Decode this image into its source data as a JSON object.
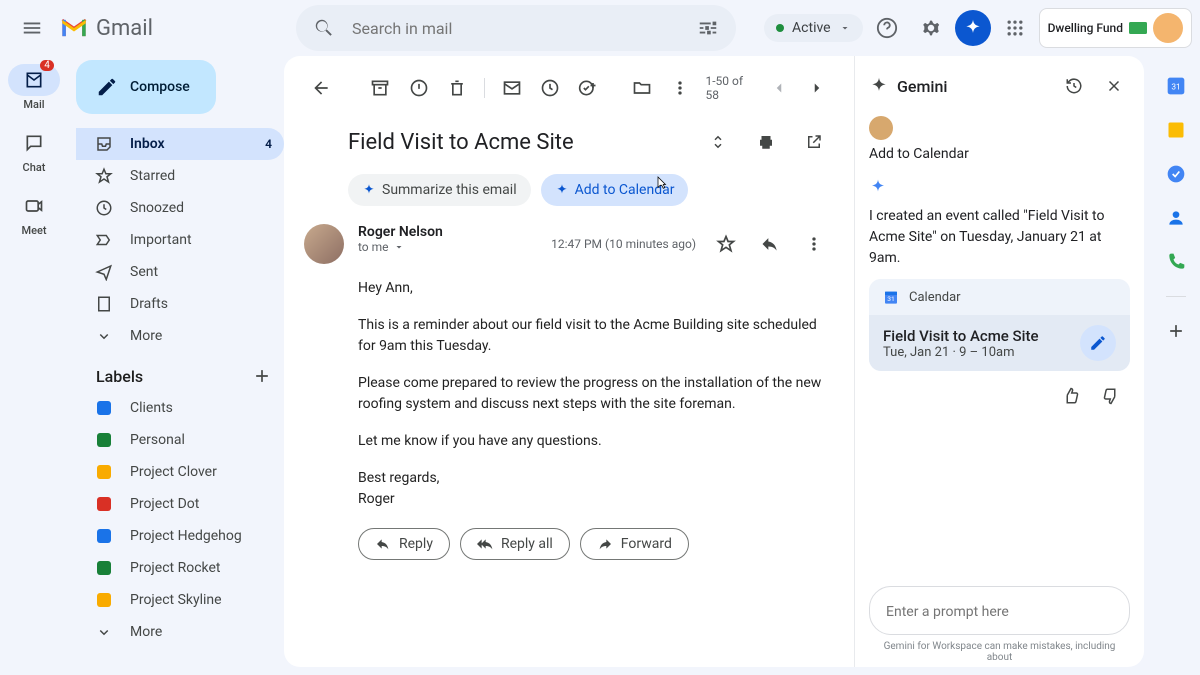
{
  "header": {
    "app_name": "Gmail",
    "search_placeholder": "Search in mail",
    "status": "Active",
    "org_name": "Dwelling Fund"
  },
  "rail": {
    "items": [
      {
        "label": "Mail",
        "badge": "4"
      },
      {
        "label": "Chat"
      },
      {
        "label": "Meet"
      }
    ]
  },
  "compose_label": "Compose",
  "nav": [
    {
      "label": "Inbox",
      "count": "4",
      "active": true
    },
    {
      "label": "Starred"
    },
    {
      "label": "Snoozed"
    },
    {
      "label": "Important"
    },
    {
      "label": "Sent"
    },
    {
      "label": "Drafts"
    },
    {
      "label": "More"
    }
  ],
  "labels_header": "Labels",
  "labels": [
    {
      "label": "Clients",
      "color": "#1a73e8"
    },
    {
      "label": "Personal",
      "color": "#188038"
    },
    {
      "label": "Project Clover",
      "color": "#f9ab00"
    },
    {
      "label": "Project Dot",
      "color": "#d93025"
    },
    {
      "label": "Project Hedgehog",
      "color": "#1a73e8"
    },
    {
      "label": "Project Rocket",
      "color": "#188038"
    },
    {
      "label": "Project Skyline",
      "color": "#f9ab00"
    },
    {
      "label": "More"
    }
  ],
  "toolbar": {
    "page_info": "1-50 of 58"
  },
  "email": {
    "subject": "Field Visit to Acme Site",
    "chips": {
      "summarize": "Summarize this email",
      "add_calendar": "Add to Calendar"
    },
    "sender": "Roger Nelson",
    "recipient": "to me",
    "timestamp": "12:47 PM (10 minutes ago)",
    "body": {
      "p1": "Hey Ann,",
      "p2": "This is a reminder about our field visit to the Acme Building site scheduled for 9am this Tuesday.",
      "p3": "Please come prepared to review the progress on the installation of the new roofing system and discuss next steps with the site foreman.",
      "p4": "Let me know if you have any questions.",
      "p5": "Best regards,",
      "p6": "Roger"
    },
    "reply_actions": {
      "reply": "Reply",
      "reply_all": "Reply all",
      "forward": "Forward"
    }
  },
  "gemini": {
    "title": "Gemini",
    "user_msg": "Add to Calendar",
    "response": "I created an event called \"Field Visit to Acme Site\" on Tuesday, January 21 at 9am.",
    "card": {
      "app": "Calendar",
      "title": "Field Visit to Acme Site",
      "time": "Tue, Jan 21 · 9 – 10am"
    },
    "input_placeholder": "Enter a prompt here",
    "disclaimer": "Gemini for Workspace can make mistakes, including about"
  }
}
